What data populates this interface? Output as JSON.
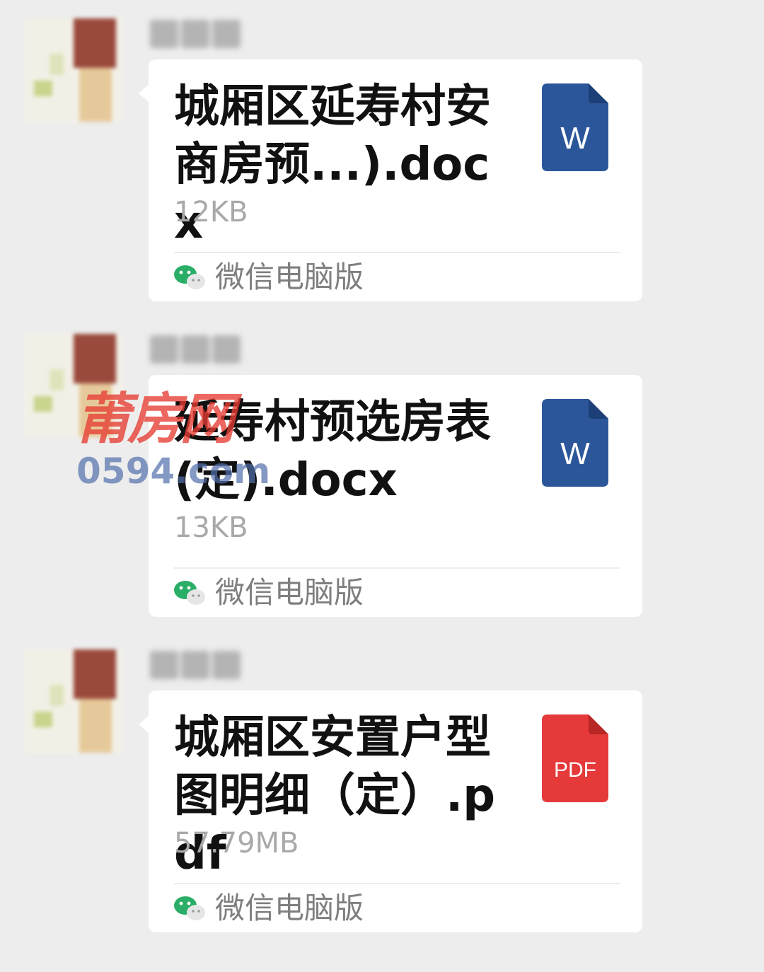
{
  "messages": [
    {
      "file_name": "城厢区延寿村安商房预...).docx",
      "file_size": "12KB",
      "file_type": "word",
      "icon_label": "W",
      "icon_color": "#2b579a",
      "source_label": "微信电脑版"
    },
    {
      "file_name": "延寿村预选房表(定).docx",
      "file_size": "13KB",
      "file_type": "word",
      "icon_label": "W",
      "icon_color": "#2b579a",
      "source_label": "微信电脑版"
    },
    {
      "file_name": "城厢区安置户型图明细（定）.pdf",
      "file_size": "57.79MB",
      "file_type": "pdf",
      "icon_label": "PDF",
      "icon_color": "#e5393a",
      "source_label": "微信电脑版"
    }
  ],
  "watermark": {
    "logo_text": "莆房网",
    "url_text": "0594.com"
  },
  "colors": {
    "background": "#ededed",
    "bubble": "#ffffff",
    "wechat_green": "#2aae67"
  }
}
